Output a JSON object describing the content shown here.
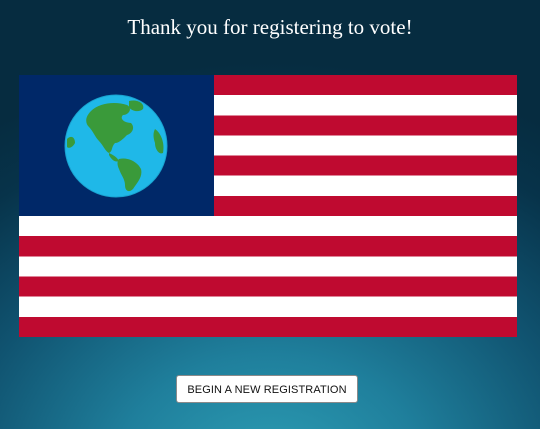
{
  "page": {
    "title": "Thank you for registering to vote!"
  },
  "flag": {
    "stripe_red": "#bf0a30",
    "stripe_white": "#ffffff",
    "canton_color": "#002868",
    "globe_ocean": "#1fb8e8",
    "globe_land": "#3a9a3a",
    "icon": "earth-globe-icon"
  },
  "actions": {
    "new_registration_label": "BEGIN A NEW REGISTRATION"
  }
}
